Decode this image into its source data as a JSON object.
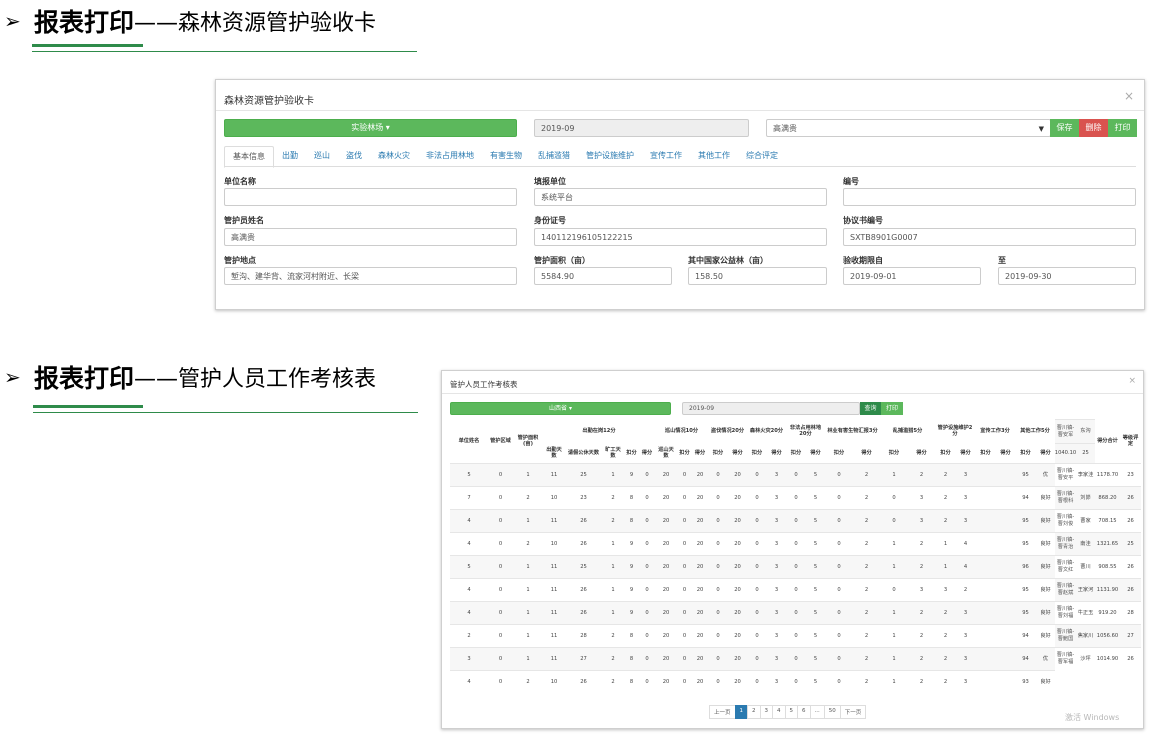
{
  "headings": [
    {
      "bold": "报表打印",
      "rest": "——森林资源管护验收卡"
    },
    {
      "bold": "报表打印",
      "rest": "——管护人员工作考核表"
    }
  ],
  "panel1": {
    "title": "森林资源管护验收卡",
    "close": "×",
    "forest_button": "实验林场 ▾",
    "date": "2019-09",
    "person_select": "高满贵",
    "save": "保存",
    "delete": "删除",
    "print": "打印",
    "tabs": [
      "基本信息",
      "出勤",
      "巡山",
      "盗伐",
      "森林火灾",
      "非法占用林地",
      "有害生物",
      "乱捕滥猎",
      "管护设施维护",
      "宣传工作",
      "其他工作",
      "综合评定"
    ],
    "fields": {
      "unit_name": {
        "label": "单位名称",
        "value": ""
      },
      "fill_unit": {
        "label": "填报单位",
        "value": "系统平台"
      },
      "number": {
        "label": "编号",
        "value": ""
      },
      "ranger_name": {
        "label": "管护员姓名",
        "value": "高满贵"
      },
      "id_number": {
        "label": "身份证号",
        "value": "140112196105122215"
      },
      "agreement_no": {
        "label": "协议书编号",
        "value": "SXTB8901G0007"
      },
      "location": {
        "label": "管护地点",
        "value": "堑沟、建华背、流家河村附近、长梁"
      },
      "area": {
        "label": "管护面积（亩）",
        "value": "5584.90"
      },
      "public_forest": {
        "label": "其中国家公益林（亩）",
        "value": "158.50"
      },
      "start_date": {
        "label": "验收期限自",
        "value": "2019-09-01"
      },
      "end_date": {
        "label": "至",
        "value": "2019-09-30"
      }
    }
  },
  "panel2": {
    "title": "管护人员工作考核表",
    "close": "×",
    "forest_button": "山西省 ▾",
    "date": "2019-09",
    "query": "查询",
    "print": "打印",
    "header_row1": [
      "单位姓名",
      "管护区域",
      "管护面积(亩)",
      "出勤在岗12分",
      "巡山情况10分",
      "盗伐情况20分",
      "森林火灾20分",
      "非法占用林地20分",
      "林业有害生物汇报3分",
      "乱捕滥猎5分",
      "管护设施维护2分",
      "宣传工作3分",
      "其他工作5分",
      "得分合计",
      "等级评定"
    ],
    "header_row2": [
      "出勤天数",
      "请假公休天数",
      "旷工天数",
      "扣分",
      "得分",
      "巡山天数",
      "扣分",
      "得分",
      "扣分",
      "得分",
      "扣分",
      "得分",
      "扣分",
      "得分",
      "扣分",
      "得分",
      "扣分",
      "得分",
      "扣分",
      "得分",
      "扣分",
      "得分",
      "扣分",
      "得分"
    ],
    "rows": [
      {
        "name": "曹川镇-曹安军",
        "area": "东沟",
        "acres": "1040.10",
        "v": [
          "25",
          "5",
          "0",
          "1",
          "11",
          "25",
          "1",
          "9",
          "0",
          "20",
          "0",
          "20",
          "0",
          "20",
          "0",
          "3",
          "0",
          "5",
          "0",
          "2",
          "1",
          "2",
          "2",
          "3"
        ],
        "total": "95",
        "grade": "优"
      },
      {
        "name": "曹川镇-曹安平",
        "area": "李家洼",
        "acres": "1178.70",
        "v": [
          "23",
          "7",
          "0",
          "2",
          "10",
          "23",
          "2",
          "8",
          "0",
          "20",
          "0",
          "20",
          "0",
          "20",
          "0",
          "3",
          "0",
          "5",
          "0",
          "2",
          "0",
          "3",
          "2",
          "3"
        ],
        "total": "94",
        "grade": "良好"
      },
      {
        "name": "曹川镇-曹根科",
        "area": "刘峁",
        "acres": "868.20",
        "v": [
          "26",
          "4",
          "0",
          "1",
          "11",
          "26",
          "2",
          "8",
          "0",
          "20",
          "0",
          "20",
          "0",
          "20",
          "0",
          "3",
          "0",
          "5",
          "0",
          "2",
          "0",
          "3",
          "2",
          "3"
        ],
        "total": "95",
        "grade": "良好"
      },
      {
        "name": "曹川镇-曹刘俊",
        "area": "曹家",
        "acres": "708.15",
        "v": [
          "26",
          "4",
          "0",
          "2",
          "10",
          "26",
          "1",
          "9",
          "0",
          "20",
          "0",
          "20",
          "0",
          "20",
          "0",
          "3",
          "0",
          "5",
          "0",
          "2",
          "1",
          "2",
          "1",
          "4"
        ],
        "total": "95",
        "grade": "良好"
      },
      {
        "name": "曹川镇-曹青治",
        "area": "南洼",
        "acres": "1321.65",
        "v": [
          "25",
          "5",
          "0",
          "1",
          "11",
          "25",
          "1",
          "9",
          "0",
          "20",
          "0",
          "20",
          "0",
          "20",
          "0",
          "3",
          "0",
          "5",
          "0",
          "2",
          "1",
          "2",
          "1",
          "4"
        ],
        "total": "96",
        "grade": "良好"
      },
      {
        "name": "曹川镇-曹文红",
        "area": "曹川",
        "acres": "908.55",
        "v": [
          "26",
          "4",
          "0",
          "1",
          "11",
          "26",
          "1",
          "9",
          "0",
          "20",
          "0",
          "20",
          "0",
          "20",
          "0",
          "3",
          "0",
          "5",
          "0",
          "2",
          "0",
          "3",
          "3",
          "2"
        ],
        "total": "95",
        "grade": "良好"
      },
      {
        "name": "曹川镇-曹赵斌",
        "area": "王家河",
        "acres": "1131.90",
        "v": [
          "26",
          "4",
          "0",
          "1",
          "11",
          "26",
          "1",
          "9",
          "0",
          "20",
          "0",
          "20",
          "0",
          "20",
          "0",
          "3",
          "0",
          "5",
          "0",
          "2",
          "1",
          "2",
          "2",
          "3"
        ],
        "total": "95",
        "grade": "良好"
      },
      {
        "name": "曹川镇-曹刘福",
        "area": "牛正玉",
        "acres": "919.20",
        "v": [
          "28",
          "2",
          "0",
          "1",
          "11",
          "28",
          "2",
          "8",
          "0",
          "20",
          "0",
          "20",
          "0",
          "20",
          "0",
          "3",
          "0",
          "5",
          "0",
          "2",
          "1",
          "2",
          "2",
          "3"
        ],
        "total": "94",
        "grade": "良好"
      },
      {
        "name": "曹川镇-曹鲍国",
        "area": "焦家川",
        "acres": "1056.60",
        "v": [
          "27",
          "3",
          "0",
          "1",
          "11",
          "27",
          "2",
          "8",
          "0",
          "20",
          "0",
          "20",
          "0",
          "20",
          "0",
          "3",
          "0",
          "5",
          "0",
          "2",
          "1",
          "2",
          "2",
          "3"
        ],
        "total": "94",
        "grade": "优"
      },
      {
        "name": "曹川镇-曹军福",
        "area": "沙坪",
        "acres": "1014.90",
        "v": [
          "26",
          "4",
          "0",
          "2",
          "10",
          "26",
          "2",
          "8",
          "0",
          "20",
          "0",
          "20",
          "0",
          "20",
          "0",
          "3",
          "0",
          "5",
          "0",
          "2",
          "1",
          "2",
          "2",
          "3"
        ],
        "total": "93",
        "grade": "良好"
      }
    ],
    "pager": [
      "上一页",
      "1",
      "2",
      "3",
      "4",
      "5",
      "6",
      "...",
      "50",
      "下一页"
    ],
    "pager_active": "1",
    "watermark": "激活 Windows"
  },
  "colors": {
    "green": "#5cb85c",
    "red": "#d9534f",
    "link": "#2a7ab0",
    "rule": "#2e8b4a"
  }
}
